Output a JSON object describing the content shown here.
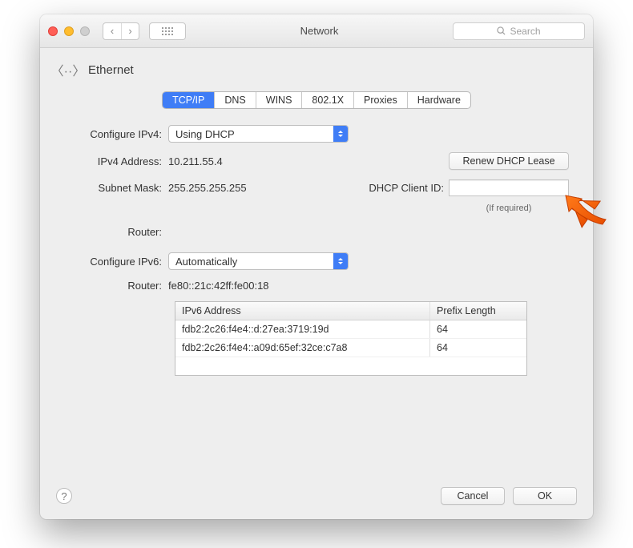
{
  "window": {
    "title": "Network"
  },
  "search": {
    "placeholder": "Search"
  },
  "page_header": {
    "label": "Ethernet"
  },
  "tabs": [
    {
      "label": "TCP/IP",
      "active": true
    },
    {
      "label": "DNS",
      "active": false
    },
    {
      "label": "WINS",
      "active": false
    },
    {
      "label": "802.1X",
      "active": false
    },
    {
      "label": "Proxies",
      "active": false
    },
    {
      "label": "Hardware",
      "active": false
    }
  ],
  "fields": {
    "configure_ipv4_label": "Configure IPv4:",
    "configure_ipv4_value": "Using DHCP",
    "ipv4_address_label": "IPv4 Address:",
    "ipv4_address_value": "10.211.55.4",
    "renew_button": "Renew DHCP Lease",
    "subnet_mask_label": "Subnet Mask:",
    "subnet_mask_value": "255.255.255.255",
    "dhcp_client_id_label": "DHCP Client ID:",
    "dhcp_client_id_value": "",
    "dhcp_hint": "(If required)",
    "router_label": "Router:",
    "router_value": "",
    "configure_ipv6_label": "Configure IPv6:",
    "configure_ipv6_value": "Automatically",
    "ipv6_router_label": "Router:",
    "ipv6_router_value": "fe80::21c:42ff:fe00:18"
  },
  "ipv6_table": {
    "col_address": "IPv6 Address",
    "col_prefix": "Prefix Length",
    "rows": [
      {
        "address": "fdb2:2c26:f4e4::d:27ea:3719:19d",
        "prefix": "64"
      },
      {
        "address": "fdb2:2c26:f4e4::a09d:65ef:32ce:c7a8",
        "prefix": "64"
      }
    ]
  },
  "footer": {
    "cancel": "Cancel",
    "ok": "OK"
  }
}
